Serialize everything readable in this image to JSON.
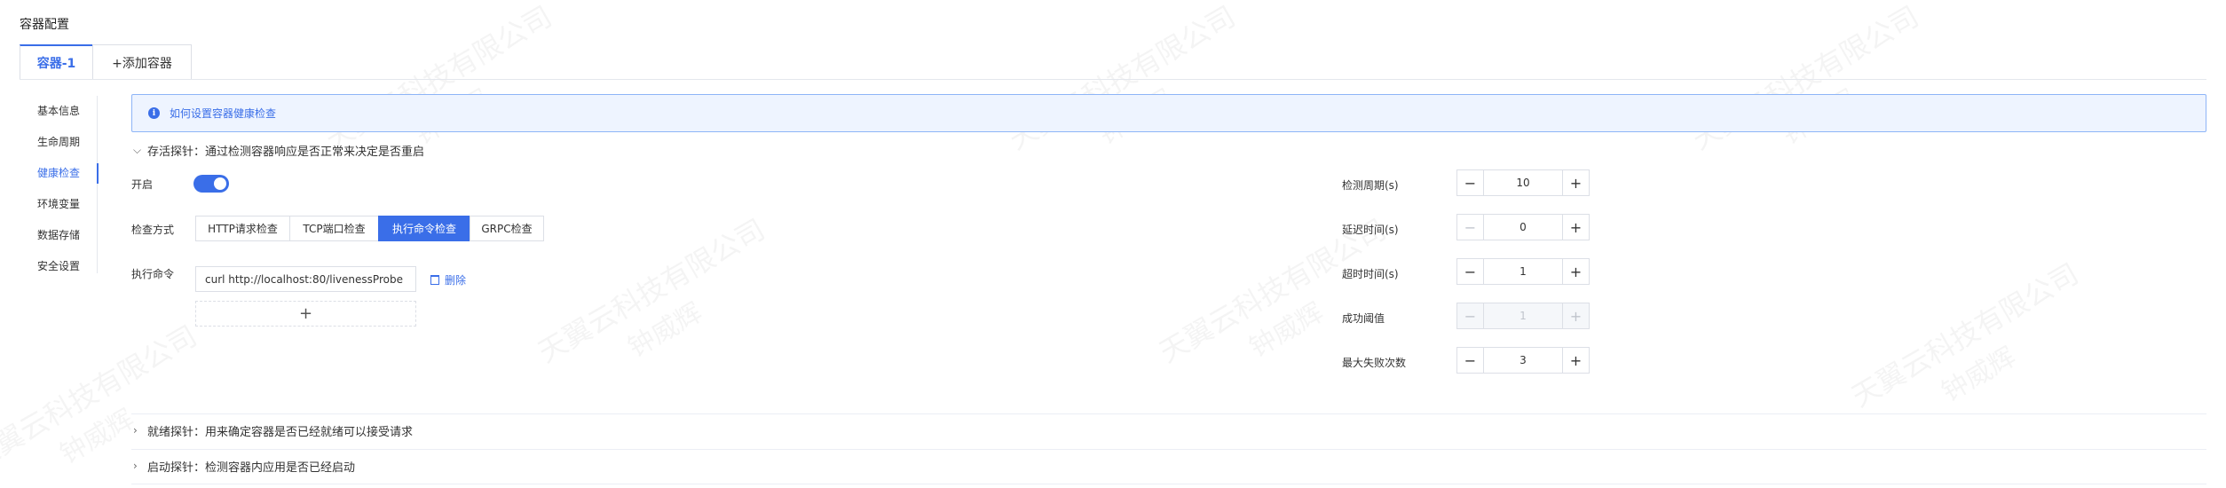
{
  "section_title": "容器配置",
  "tabs": [
    {
      "label": "容器-1",
      "active": true
    },
    {
      "label": "+添加容器",
      "active": false
    }
  ],
  "sidebar": {
    "items": [
      {
        "label": "基本信息"
      },
      {
        "label": "生命周期"
      },
      {
        "label": "健康检查",
        "active": true
      },
      {
        "label": "环境变量"
      },
      {
        "label": "数据存储"
      },
      {
        "label": "安全设置"
      }
    ]
  },
  "info_banner": {
    "icon": "info-icon",
    "text": "如何设置容器健康检查"
  },
  "liveness": {
    "header": "存活探针：通过检测容器响应是否正常来决定是否重启",
    "expanded": true,
    "enabled_label": "开启",
    "enabled": true,
    "method_label": "检查方式",
    "methods": [
      "HTTP请求检查",
      "TCP端口检查",
      "执行命令检查",
      "GRPC检查"
    ],
    "active_method": "执行命令检查",
    "command_label": "执行命令",
    "command_value": "curl http://localhost:80/livenessProbe",
    "delete_label": "删除",
    "add_symbol": "+",
    "params": [
      {
        "label": "检测周期(s)",
        "value": "10",
        "disabled": false
      },
      {
        "label": "延迟时间(s)",
        "value": "0",
        "disabled": false,
        "minus_disabled": true
      },
      {
        "label": "超时时间(s)",
        "value": "1",
        "disabled": false
      },
      {
        "label": "成功阈值",
        "value": "1",
        "disabled": true
      },
      {
        "label": "最大失败次数",
        "value": "3",
        "disabled": false
      }
    ]
  },
  "readiness": {
    "header": "就绪探针：用来确定容器是否已经就绪可以接受请求",
    "expanded": false
  },
  "startup": {
    "header": "启动探针：检测容器内应用是否已经启动",
    "expanded": false
  },
  "watermark": {
    "line1": "天翼云科技有限公司",
    "line2": "钟威辉"
  },
  "colors": {
    "accent": "#3a6ee8",
    "info_bg": "#eef4ff",
    "info_border": "#8eb5f7"
  }
}
